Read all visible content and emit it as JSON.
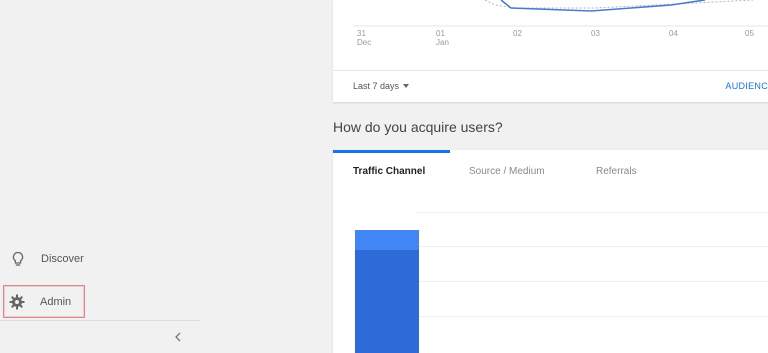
{
  "sidebar": {
    "items": [
      {
        "label": "Discover",
        "icon": "lightbulb-icon"
      },
      {
        "label": "Admin",
        "icon": "gear-icon"
      }
    ],
    "collapse_icon": "chevron-left-icon"
  },
  "overview_card": {
    "x_ticks": [
      {
        "day": "31",
        "month": "Dec"
      },
      {
        "day": "01",
        "month": "Jan"
      },
      {
        "day": "02",
        "month": ""
      },
      {
        "day": "03",
        "month": ""
      },
      {
        "day": "04",
        "month": ""
      },
      {
        "day": "05",
        "month": ""
      }
    ],
    "date_range": "Last 7 days",
    "audience_link": "AUDIENC"
  },
  "acquisition": {
    "title": "How do you acquire users?",
    "tabs": [
      "Traffic Channel",
      "Source / Medium",
      "Referrals"
    ],
    "active_tab": 0
  },
  "colors": {
    "accent": "#1a73e8",
    "bar_light": "#4285f4",
    "bar_dark": "#2f6bd8",
    "admin_highlight": "#d98b95"
  }
}
